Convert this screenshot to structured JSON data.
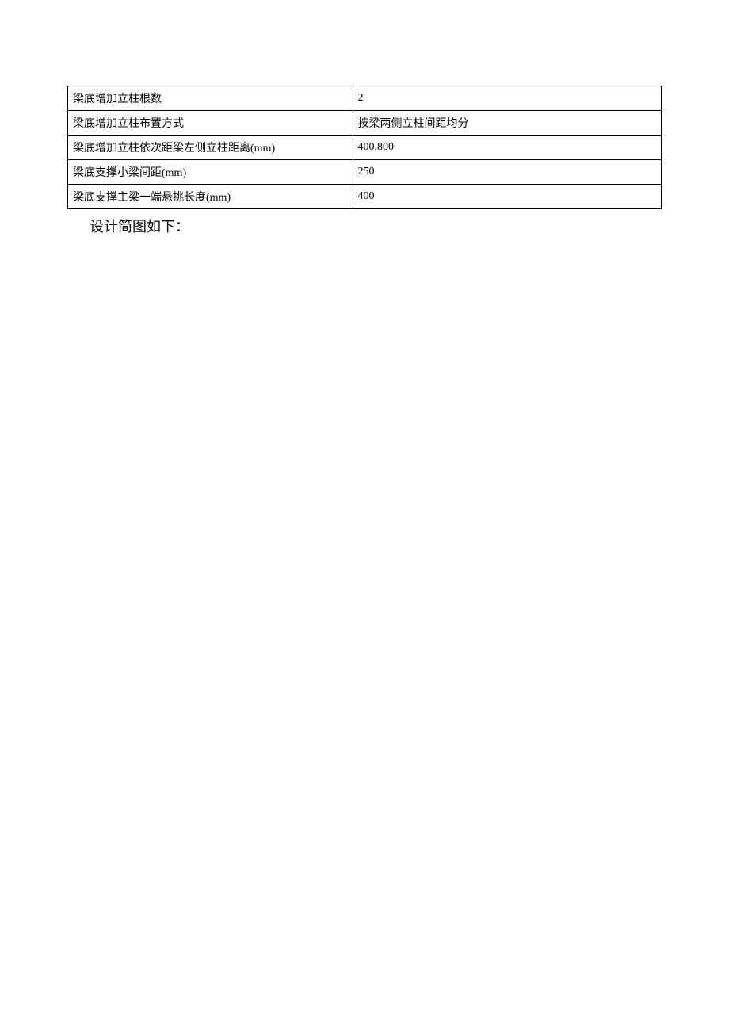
{
  "table": {
    "rows": [
      {
        "label": "梁底增加立柱根数",
        "value": "2"
      },
      {
        "label": "梁底增加立柱布置方式",
        "value": "按梁两侧立柱间距均分"
      },
      {
        "label": "梁底增加立柱依次距梁左侧立柱距离(mm)",
        "value": "400,800"
      },
      {
        "label": "梁底支撑小梁间距(mm)",
        "value": "250"
      },
      {
        "label": "梁底支撑主梁一端悬挑长度(mm)",
        "value": "400"
      }
    ]
  },
  "caption": "设计简图如下："
}
